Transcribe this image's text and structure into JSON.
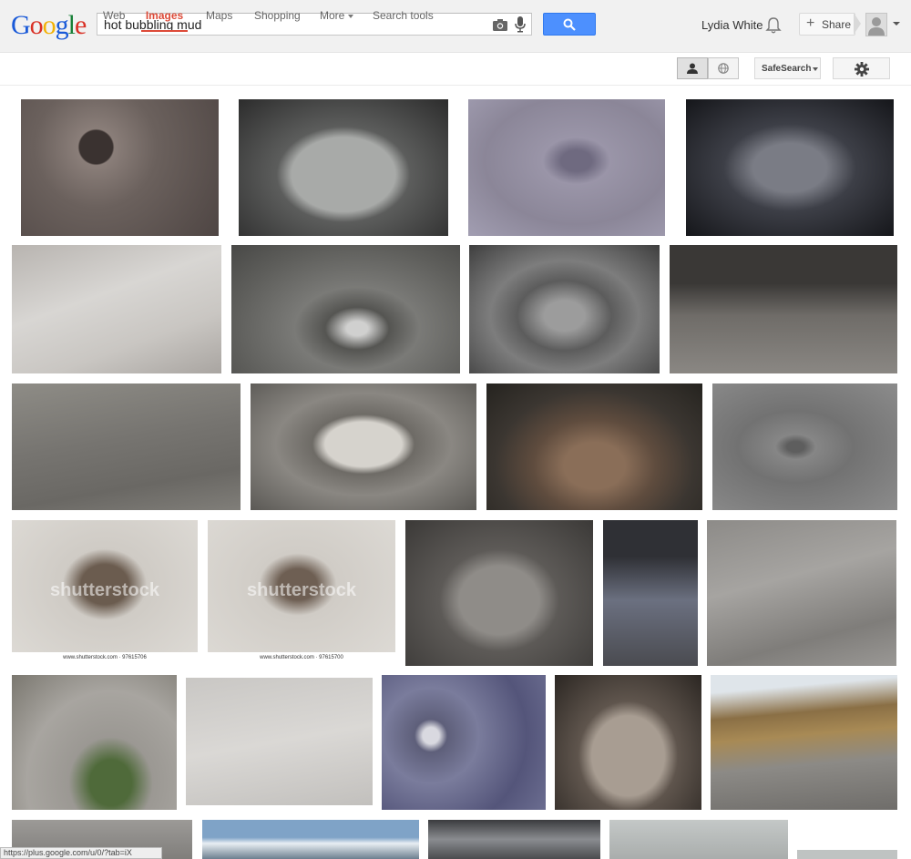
{
  "logo": [
    "G",
    "o",
    "o",
    "g",
    "l",
    "e"
  ],
  "logo_colors": [
    "#1a5ad8",
    "#d93025",
    "#f2b105",
    "#1a5ad8",
    "#188038",
    "#d93025"
  ],
  "search": {
    "query": "hot bubbling mud"
  },
  "header": {
    "user_name": "Lydia White",
    "share_label": "Share"
  },
  "nav": {
    "tabs": [
      {
        "label": "Web"
      },
      {
        "label": "Images"
      },
      {
        "label": "Maps"
      },
      {
        "label": "Shopping"
      },
      {
        "label": "More"
      },
      {
        "label": "Search tools"
      }
    ],
    "active_tab": "Images",
    "safesearch_label": "SafeSearch"
  },
  "watermark": {
    "text": "shutterstock",
    "footer_1": "www.shutterstock.com · 97615706",
    "footer_2": "www.shutterstock.com · 97615700"
  },
  "status_bar": "https://plus.google.com/u/0/?tab=iX",
  "colors": {
    "accent": "#dd4b39",
    "search_button": "#4d90fe",
    "header_bg": "#f1f1f1"
  }
}
